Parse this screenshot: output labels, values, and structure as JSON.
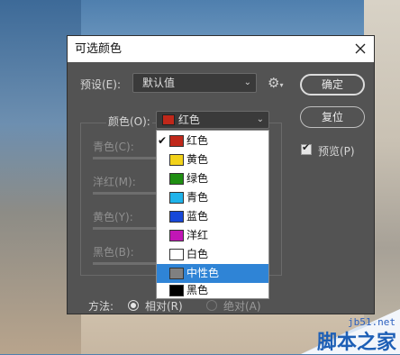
{
  "dialog": {
    "title": "可选颜色",
    "preset_label": "预设(E):",
    "preset_value": "默认值",
    "color_label": "颜色(O):",
    "color_value": "红色",
    "color_value_swatch": "#c0281a",
    "ok_button": "确定",
    "reset_button": "复位",
    "preview_label": "预览(P)",
    "preview_checked": true,
    "sliders": [
      {
        "label": "青色(C):"
      },
      {
        "label": "洋红(M):"
      },
      {
        "label": "黄色(Y):"
      },
      {
        "label": "黑色(B):"
      }
    ],
    "method_label": "方法:",
    "method_options": [
      {
        "label": "相对(R)",
        "selected": true
      },
      {
        "label": "绝对(A)",
        "selected": false
      }
    ]
  },
  "color_menu": {
    "items": [
      {
        "label": "红色",
        "swatch": "#c0281a",
        "checked": true,
        "highlighted": false
      },
      {
        "label": "黄色",
        "swatch": "#f2d21a",
        "checked": false,
        "highlighted": false
      },
      {
        "label": "绿色",
        "swatch": "#1f8f12",
        "checked": false,
        "highlighted": false
      },
      {
        "label": "青色",
        "swatch": "#1fb3ea",
        "checked": false,
        "highlighted": false
      },
      {
        "label": "蓝色",
        "swatch": "#1748d8",
        "checked": false,
        "highlighted": false
      },
      {
        "label": "洋红",
        "swatch": "#c116b6",
        "checked": false,
        "highlighted": false
      },
      {
        "label": "白色",
        "swatch": "#ffffff",
        "checked": false,
        "highlighted": false
      },
      {
        "label": "中性色",
        "swatch": "#808080",
        "checked": false,
        "highlighted": true
      },
      {
        "label": "黑色",
        "swatch": "#000000",
        "checked": false,
        "highlighted": false
      }
    ]
  },
  "watermark": {
    "url": "jb51.net",
    "name": "脚本之家"
  },
  "icons": {
    "close": "close-icon",
    "gear": "gear-icon",
    "chevron": "chevron-down-icon",
    "check": "check-icon"
  }
}
